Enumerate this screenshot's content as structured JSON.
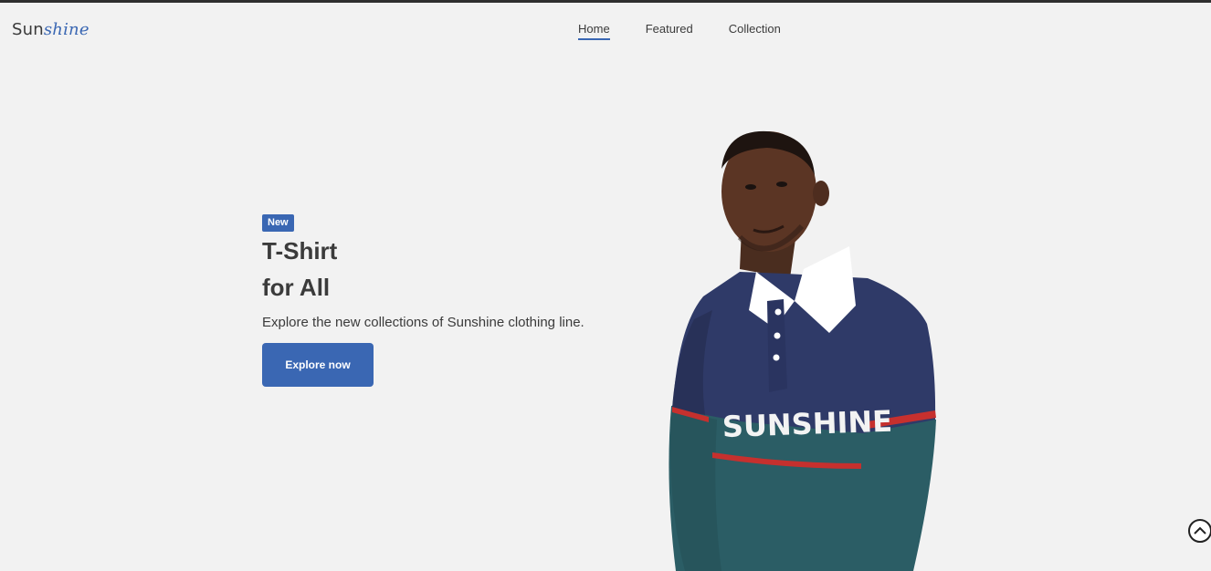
{
  "brand": {
    "part1": "Sun",
    "part2": "shine"
  },
  "nav": {
    "items": [
      {
        "label": "Home",
        "active": true
      },
      {
        "label": "Featured",
        "active": false
      },
      {
        "label": "Collection",
        "active": false
      }
    ]
  },
  "hero": {
    "badge": "New",
    "title_line1": "T-Shirt",
    "title_line2": "for All",
    "description": "Explore the new collections of Sunshine clothing line.",
    "cta_label": "Explore now",
    "shirt_text": "SUNSHINE"
  },
  "icons": {
    "scroll_top": "chevron-up-icon"
  },
  "colors": {
    "accent": "#3a67b3",
    "background": "#f2f2f2",
    "text": "#3b3b3b"
  }
}
